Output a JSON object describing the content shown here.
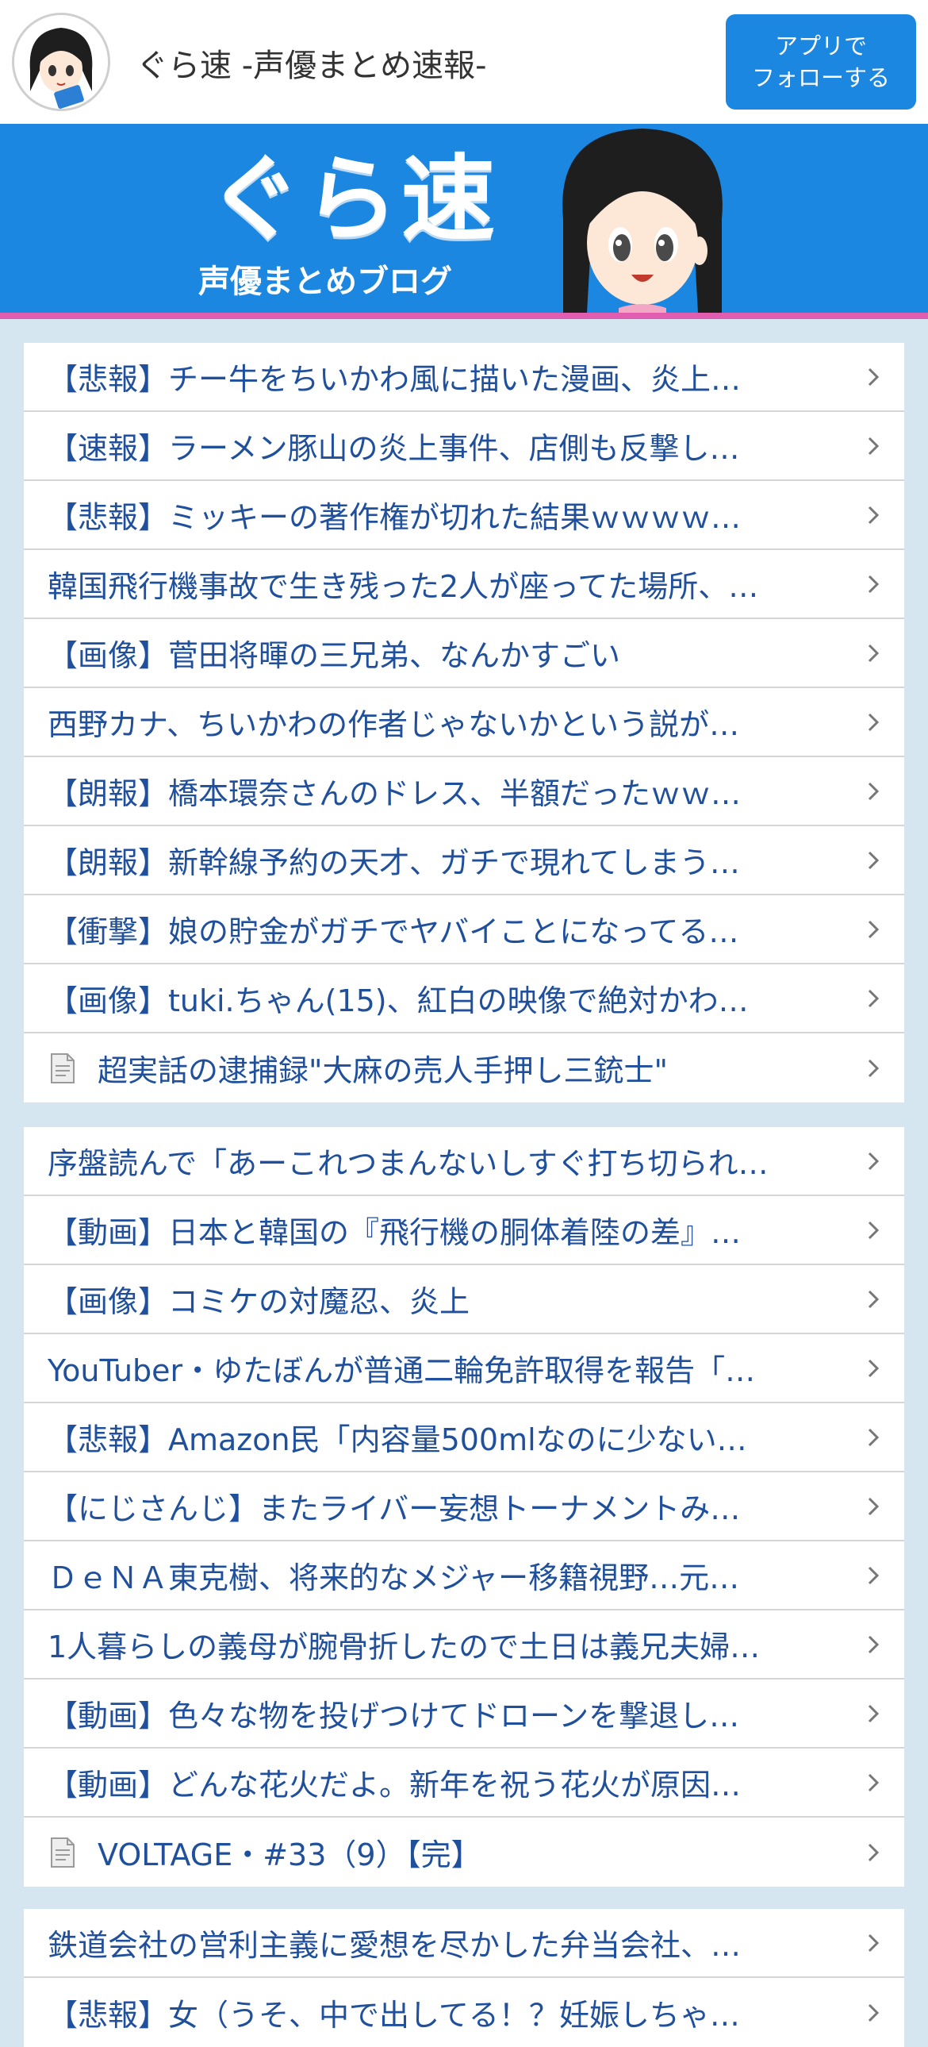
{
  "header": {
    "title": "ぐら速 -声優まとめ速報-",
    "follow_line1": "アプリで",
    "follow_line2": "フォローする"
  },
  "banner": {
    "brand_main": "ぐら速",
    "brand_sub": "声優まとめブログ"
  },
  "colors": {
    "accent": "#1b87e0",
    "link": "#20509c",
    "banner_line": "#e05db0",
    "page_bg": "#d6e6f1"
  },
  "lists": [
    {
      "items": [
        {
          "text": "【悲報】チー牛をちいかわ風に描いた漫画、炎上…"
        },
        {
          "text": "【速報】ラーメン豚山の炎上事件、店側も反撃し…"
        },
        {
          "text": "【悲報】ミッキーの著作権が切れた結果ｗｗｗｗ…"
        },
        {
          "text": "韓国飛行機事故で生き残った2人が座ってた場所、…"
        },
        {
          "text": "【画像】菅田将暉の三兄弟、なんかすごい"
        },
        {
          "text": "西野カナ、ちいかわの作者じゃないかという説が…"
        },
        {
          "text": "【朗報】橋本環奈さんのドレス、半額だったｗｗ…"
        },
        {
          "text": "【朗報】新幹線予約の天才、ガチで現れてしまう…"
        },
        {
          "text": "【衝撃】娘の貯金がガチでヤバイことになってる…"
        },
        {
          "text": "【画像】tuki.ちゃん(15)、紅白の映像で絶対かわ…"
        },
        {
          "text": "超実話の逮捕録\"大麻の売人手押し三銃士\"",
          "icon": "document-icon"
        }
      ]
    },
    {
      "items": [
        {
          "text": "序盤読んで「あーこれつまんないしすぐ打ち切られ…"
        },
        {
          "text": "【動画】日本と韓国の『飛行機の胴体着陸の差』…"
        },
        {
          "text": "【画像】コミケの対魔忍、炎上"
        },
        {
          "text": "YouTuber・ゆたぼんが普通二輪免許取得を報告「…"
        },
        {
          "text": "【悲報】Amazon民「内容量500mlなのに少ない…"
        },
        {
          "text": "【にじさんじ】またライバー妄想トーナメントみ…"
        },
        {
          "text": "ＤｅＮＡ東克樹、将来的なメジャー移籍視野…元…"
        },
        {
          "text": "1人暮らしの義母が腕骨折したので土日は義兄夫婦…"
        },
        {
          "text": "【動画】色々な物を投げつけてドローンを撃退し…"
        },
        {
          "text": "【動画】どんな花火だよ。新年を祝う花火が原因…"
        },
        {
          "text": "VOLTAGE・#33（9）【完】",
          "icon": "document-icon"
        }
      ]
    },
    {
      "items": [
        {
          "text": "鉄道会社の営利主義に愛想を尽かした弁当会社、…"
        },
        {
          "text": "【悲報】女（うそ、中で出してる！？妊娠しちゃ…"
        }
      ]
    }
  ]
}
